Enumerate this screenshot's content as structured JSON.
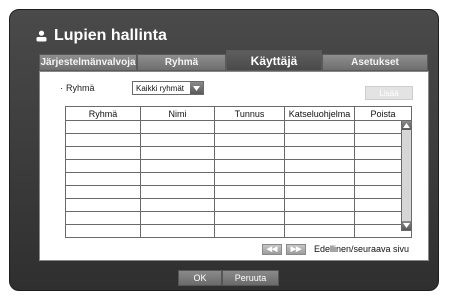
{
  "window": {
    "title": "Lupien hallinta",
    "title_icon": "user-icon"
  },
  "tabs": [
    {
      "label": "Järjestelmänvalvoja",
      "active": false
    },
    {
      "label": "Ryhmä",
      "active": false
    },
    {
      "label": "Käyttäjä",
      "active": true
    },
    {
      "label": "Asetukset",
      "active": false
    }
  ],
  "filter": {
    "bullet": "·",
    "label": "Ryhmä",
    "selected": "Kaikki ryhmät"
  },
  "add_button": {
    "label": "Lisää",
    "enabled": false
  },
  "table": {
    "columns": [
      "Ryhmä",
      "Nimi",
      "Tunnus",
      "Katseluohjelma",
      "Poista"
    ],
    "empty_rows": 9
  },
  "pagination": {
    "prev_label": "◀◀",
    "next_label": "▶▶",
    "text": "Edellinen/seuraava sivu"
  },
  "footer": {
    "ok_label": "OK",
    "cancel_label": "Peruuta"
  },
  "colors": {
    "frame": "#3c3c3c",
    "tab_inactive": "#7e7e7e",
    "tab_active": "#545454"
  }
}
